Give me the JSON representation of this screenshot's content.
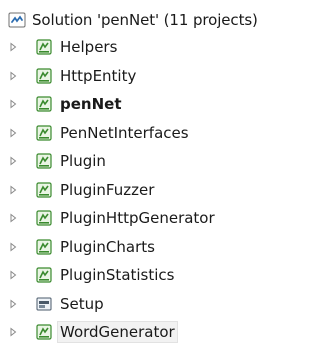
{
  "solution": {
    "label": "Solution 'penNet' (11 projects)",
    "icon": "visual-studio-solution-icon"
  },
  "projects": [
    {
      "label": "Helpers",
      "icon": "csharp-project-icon"
    },
    {
      "label": "HttpEntity",
      "icon": "csharp-project-icon"
    },
    {
      "label": "penNet",
      "icon": "csharp-project-icon",
      "bold": true
    },
    {
      "label": "PenNetInterfaces",
      "icon": "csharp-project-icon"
    },
    {
      "label": "Plugin",
      "icon": "csharp-project-icon"
    },
    {
      "label": "PluginFuzzer",
      "icon": "csharp-project-icon"
    },
    {
      "label": "PluginHttpGenerator",
      "icon": "csharp-project-icon"
    },
    {
      "label": "PluginCharts",
      "icon": "csharp-project-icon"
    },
    {
      "label": "PluginStatistics",
      "icon": "csharp-project-icon"
    },
    {
      "label": "Setup",
      "icon": "setup-project-icon"
    },
    {
      "label": "WordGenerator",
      "icon": "csharp-project-icon",
      "selected": true
    }
  ],
  "colors": {
    "project_icon_green": "#3a8a2e",
    "solution_icon_blue": "#2b6cb0",
    "expander_gray": "#8a8a8a"
  }
}
